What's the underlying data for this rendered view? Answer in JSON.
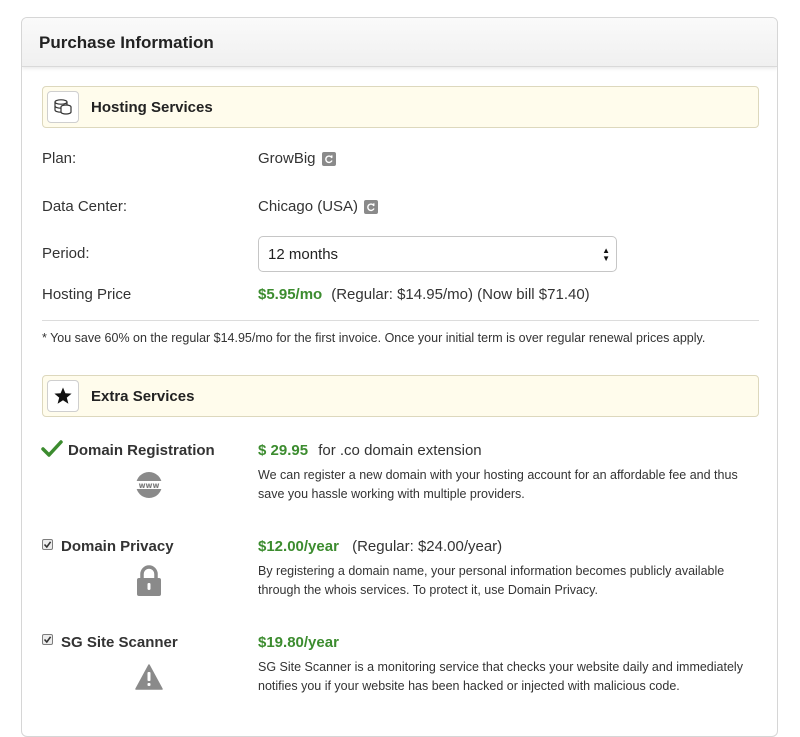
{
  "header": {
    "title": "Purchase Information"
  },
  "hosting": {
    "section_title": "Hosting Services",
    "plan_label": "Plan:",
    "plan_value": "GrowBig",
    "dc_label": "Data Center:",
    "dc_value": "Chicago (USA)",
    "period_label": "Period:",
    "period_value": "12 months",
    "price_label": "Hosting Price",
    "price_value": "$5.95/mo",
    "price_detail": "(Regular: $14.95/mo) (Now bill $71.40)",
    "note": "* You save 60% on the regular $14.95/mo for the first invoice. Once your initial term is over regular renewal prices apply."
  },
  "extra": {
    "section_title": "Extra Services",
    "items": [
      {
        "name": "Domain Registration",
        "price": "$ 29.95",
        "price_suffix": "for .co domain extension",
        "desc": "We can register a new domain with your hosting account for an affordable fee and thus save you hassle working with multiple providers.",
        "icon": "www-icon",
        "state": "checked-mark"
      },
      {
        "name": "Domain Privacy",
        "price": "$12.00/year",
        "price_suffix": "(Regular: $24.00/year)",
        "desc": "By registering a domain name, your personal information becomes publicly available through the whois services. To protect it, use Domain Privacy.",
        "icon": "lock-icon",
        "state": "checked"
      },
      {
        "name": "SG Site Scanner",
        "price": "$19.80/year",
        "price_suffix": "",
        "desc": "SG Site Scanner is a monitoring service that checks your website daily and immediately notifies you if your website has been hacked or injected with malicious code.",
        "icon": "warning-icon",
        "state": "checked"
      }
    ]
  },
  "colors": {
    "accent_green": "#3c8c2f",
    "section_bg": "#fffcec",
    "icon_gray": "#8a8a8a"
  }
}
